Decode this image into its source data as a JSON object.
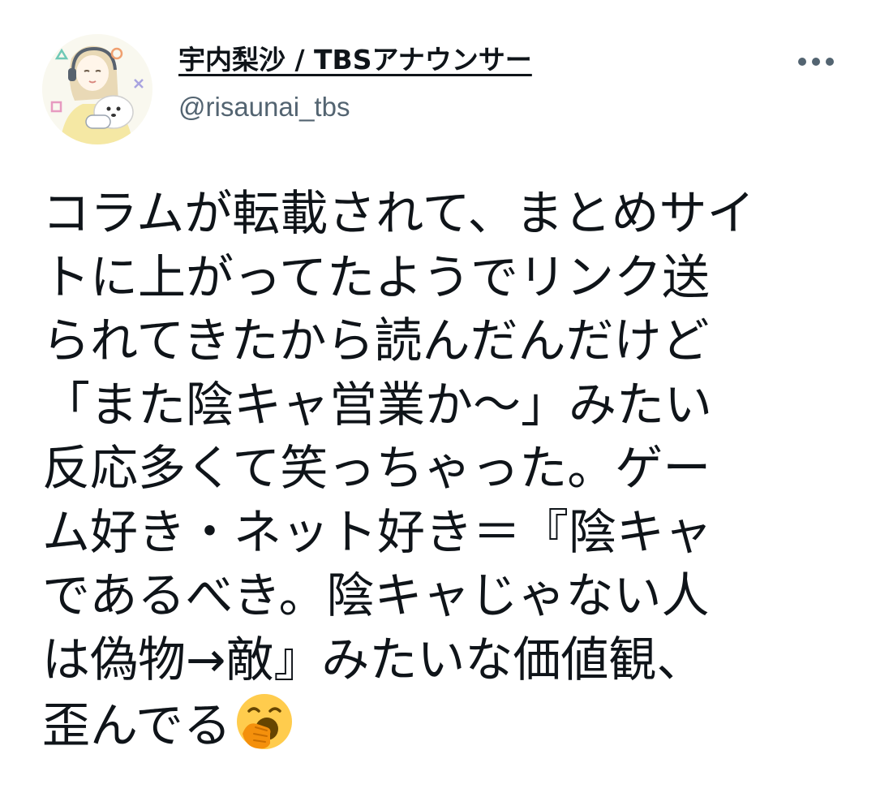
{
  "tweet": {
    "author": {
      "display_name": "宇内梨沙 / TBSアナウンサー",
      "handle": "@risaunai_tbs",
      "avatar_icon": "user-avatar-illustration"
    },
    "more_icon": "more-horizontal-icon",
    "text_lines": [
      "コラムが転載されて、まとめサイ",
      "トに上がってたようでリンク送",
      "られてきたから読んだんだけど",
      "「また陰キャ営業か～」みたい",
      "反応多くて笑っちゃった。ゲー",
      "ム好き・ネット好き＝『陰キャ",
      "であるべき。陰キャじゃない人",
      "は偽物→敵』みたいな価値観、",
      "歪んでる"
    ],
    "trailing_emoji": "yawning-face-emoji"
  },
  "colors": {
    "text_primary": "#0f1419",
    "text_secondary": "#536471",
    "background": "#ffffff",
    "emoji_face": "#ffcc4d",
    "emoji_hand": "#f4900c"
  }
}
